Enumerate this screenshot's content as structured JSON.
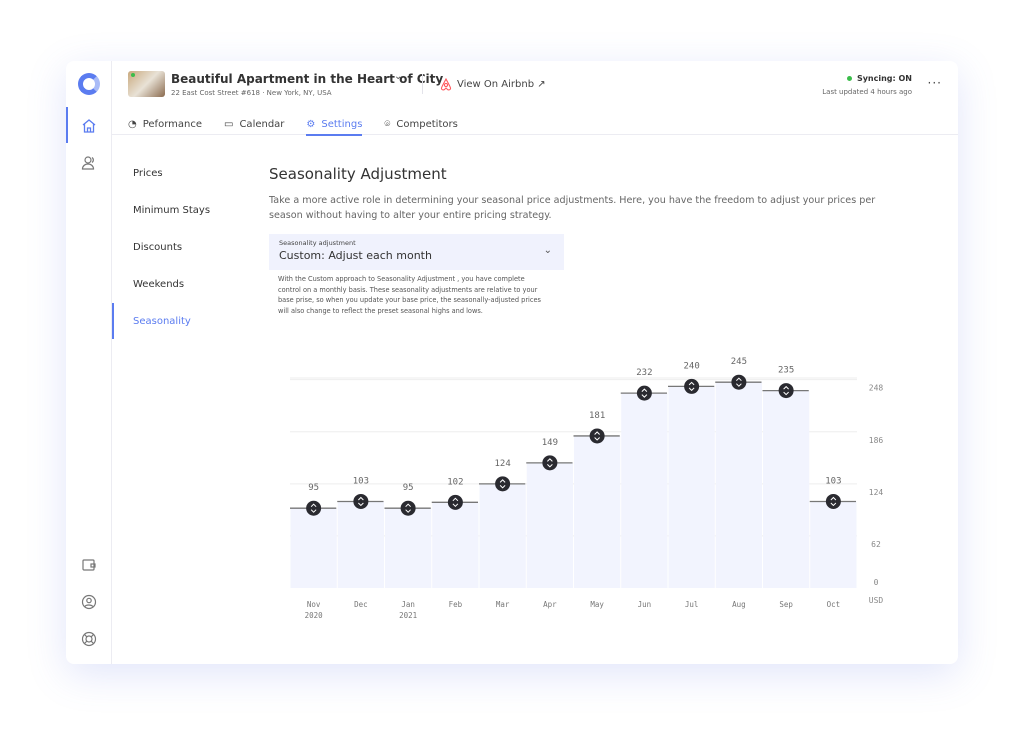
{
  "header": {
    "title": "Beautiful Apartment in the Heart of City",
    "address": "22 East Cost Street #618 · New York, NY, USA",
    "airbnb_link": "View On Airbnb ↗",
    "sync_status": "Syncing: ON",
    "last_updated": "Last updated 4 hours ago",
    "more": "···"
  },
  "tabs": [
    {
      "label": "Peformance",
      "icon": "gauge-icon"
    },
    {
      "label": "Calendar",
      "icon": "calendar-icon"
    },
    {
      "label": "Settings",
      "icon": "gear-icon",
      "active": true
    },
    {
      "label": "Competitors",
      "icon": "map-pin-icon"
    }
  ],
  "sidebar": {
    "icons": [
      "home-icon",
      "users-icon",
      "wallet-icon",
      "user-circle-icon",
      "lifebuoy-icon"
    ]
  },
  "subnav": [
    {
      "label": "Prices"
    },
    {
      "label": "Minimum Stays"
    },
    {
      "label": "Discounts"
    },
    {
      "label": "Weekends"
    },
    {
      "label": "Seasonality",
      "active": true
    }
  ],
  "main": {
    "title": "Seasonality Adjustment",
    "description": "Take a more active role in determining your seasonal price adjustments. Here, you have the freedom to adjust your prices per season without having to alter your entire pricing strategy.",
    "select": {
      "label": "Seasonality adjustment",
      "value": "Custom: Adjust each month"
    },
    "help": "With the Custom approach to Seasonality Adjustment , you have complete control on a monthly basis. These seasonality adjustments are relative to your base prise, so when you update your base price, the seasonally-adjusted prices will also change to reflect the preset seasonal highs and lows."
  },
  "colors": {
    "accent": "#5b7cf0",
    "bar_fill": "#f2f4fe",
    "handle": "#2a2a30"
  },
  "chart_data": {
    "type": "bar",
    "categories": [
      "Nov",
      "Dec",
      "Jan",
      "Feb",
      "Mar",
      "Apr",
      "May",
      "Jun",
      "Jul",
      "Aug",
      "Sep",
      "Oct"
    ],
    "years": [
      "2020",
      "",
      "2021",
      "",
      "",
      "",
      "",
      "",
      "",
      "",
      "",
      ""
    ],
    "values": [
      95,
      103,
      95,
      102,
      124,
      149,
      181,
      232,
      240,
      245,
      235,
      103
    ],
    "yticks": [
      0,
      62,
      124,
      186,
      248
    ],
    "ylabel": "USD",
    "ylim": [
      0,
      250
    ],
    "grid": true
  }
}
